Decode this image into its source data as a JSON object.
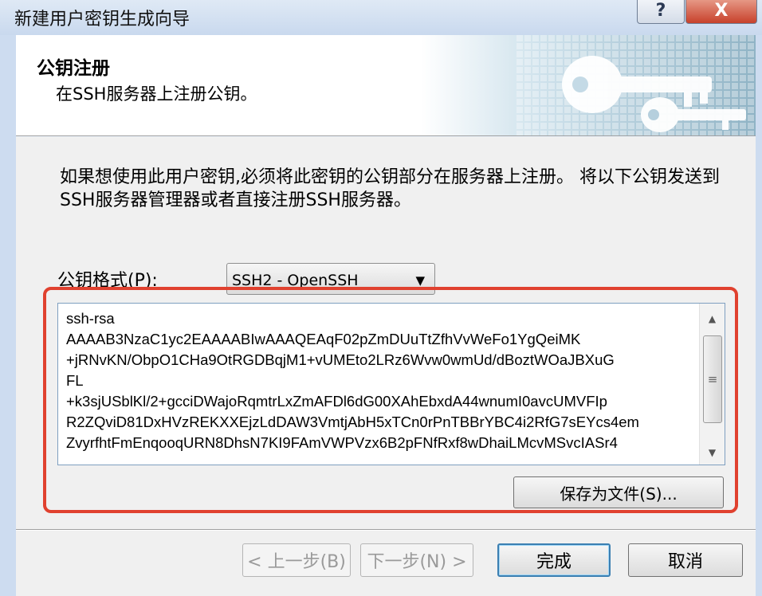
{
  "window": {
    "title": "新建用户密钥生成向导",
    "help_label": "?",
    "close_label": "X"
  },
  "header": {
    "title": "公钥注册",
    "subtitle": "在SSH服务器上注册公钥。"
  },
  "body": {
    "description": "如果想使用此用户密钥,必须将此密钥的公钥部分在服务器上注册。 将以下公钥发送到SSH服务器管理器或者直接注册SSH服务器。",
    "format_label": "公钥格式(P):",
    "format_value": "SSH2 - OpenSSH",
    "public_key": "ssh-rsa\nAAAAB3NzaC1yc2EAAAABIwAAAQEAqF02pZmDUuTtZfhVvWeFo1YgQeiMK\n+jRNvKN/ObpO1CHa9OtRGDBqjM1+vUMEto2LRz6Wvw0wmUd/dBoztWOaJBXuG\nFL\n+k3sjUSblKl/2+gcciDWajoRqmtrLxZmAFDl6dG00XAhEbxdA44wnumI0avcUMVFIp\nR2ZQviD81DxHVzREKXXEjzLdDAW3VmtjAbH5xTCn0rPnTBBrYBC4i2RfG7sEYcs4em\nZvyrfhtFmEnqooqURN8DhsN7KI9FAmVWPVzx6B2pFNfRxf8wDhaiLMcvMSvcIASr4",
    "save_button": "保存为文件(S)..."
  },
  "footer": {
    "back_button": "< 上一步(B)",
    "next_button": "下一步(N) >",
    "finish_button": "完成",
    "cancel_button": "取消"
  },
  "colors": {
    "highlight": "#e0412f",
    "default_button_border": "#3c7fb1"
  }
}
